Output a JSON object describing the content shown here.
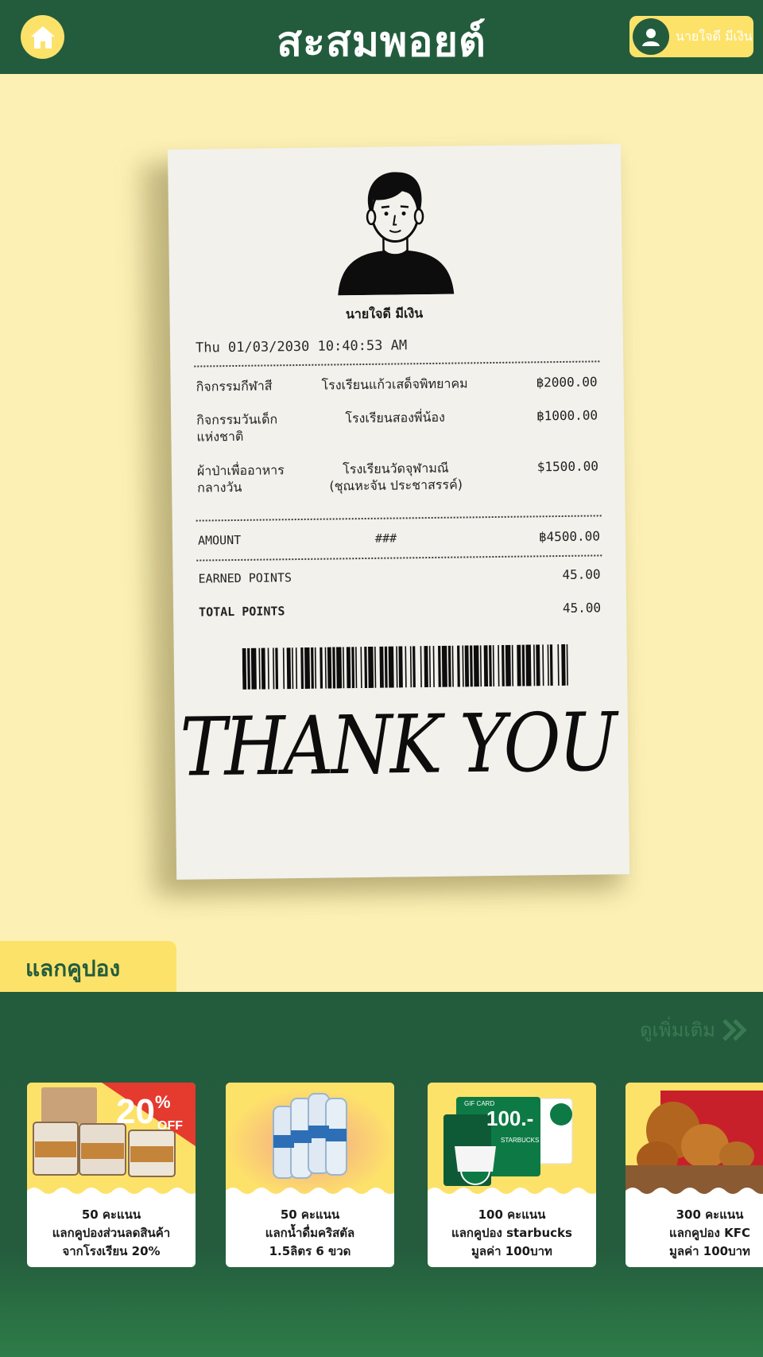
{
  "header": {
    "title": "สะสมพอยต์",
    "user_name": "นายใจดี มีเงิน"
  },
  "receipt": {
    "name": "นายใจดี   มีเงิน",
    "datetime": "Thu 01/03/2030 10:40:53 AM",
    "items": [
      {
        "activity": "กิจกรรมกีฬาสี",
        "school": "โรงเรียนแก้วเสด็จพิทยาคม",
        "amount": "฿2000.00"
      },
      {
        "activity": "กิจกรรมวันเด็กแห่งชาติ",
        "school": "โรงเรียนสองพี่น้อง",
        "amount": "฿1000.00"
      },
      {
        "activity": "ผ้าป่าเพื่ออาหารกลางวัน",
        "school": "โรงเรียนวัดจุฬามณี (ชุณหะจัน ประชาสรรค์)",
        "amount": "$1500.00"
      }
    ],
    "amount_label": "AMOUNT",
    "amount_mid": "###",
    "amount_total": "฿4500.00",
    "earned_label": "EARNED POINTS",
    "earned_value": "45.00",
    "total_label": "TOTAL POINTS",
    "total_value": "45.00",
    "thank_you": "THANK YOU"
  },
  "coupons": {
    "section_title": "แลกคูปอง",
    "see_more": "ดูเพิ่มเติม",
    "cards": [
      {
        "line1": "50 คะแนน",
        "line2": "แลกคูปองส่วนลดสินค้า",
        "line3": "จากโรงเรียน 20%",
        "badge": "20",
        "badge_pct": "%",
        "badge_off": "OFF"
      },
      {
        "line1": "50 คะแนน",
        "line2": "แลกน้ำดื่มคริสตัล",
        "line3": "1.5ลิตร 6 ขวด"
      },
      {
        "line1": "100 คะแนน",
        "line2": "แลกคูปอง starbucks",
        "line3": "มูลค่า 100บาท",
        "gift_label": "GIF CARD",
        "gift_value": "100.-",
        "gift_brand": "STARBUCKS CARD"
      },
      {
        "line1": "300 คะแนน",
        "line2": "แลกคูปอง KFC",
        "line3": "มูลค่า 100บาท"
      }
    ]
  },
  "colors": {
    "primary_green": "#235c3d",
    "accent_yellow": "#fde26a",
    "background": "#fdf0b4",
    "paper": "#f2f1ec"
  },
  "icons": {
    "home": "home-icon",
    "user": "user-icon",
    "see_more": "double-chevron-right-icon"
  }
}
